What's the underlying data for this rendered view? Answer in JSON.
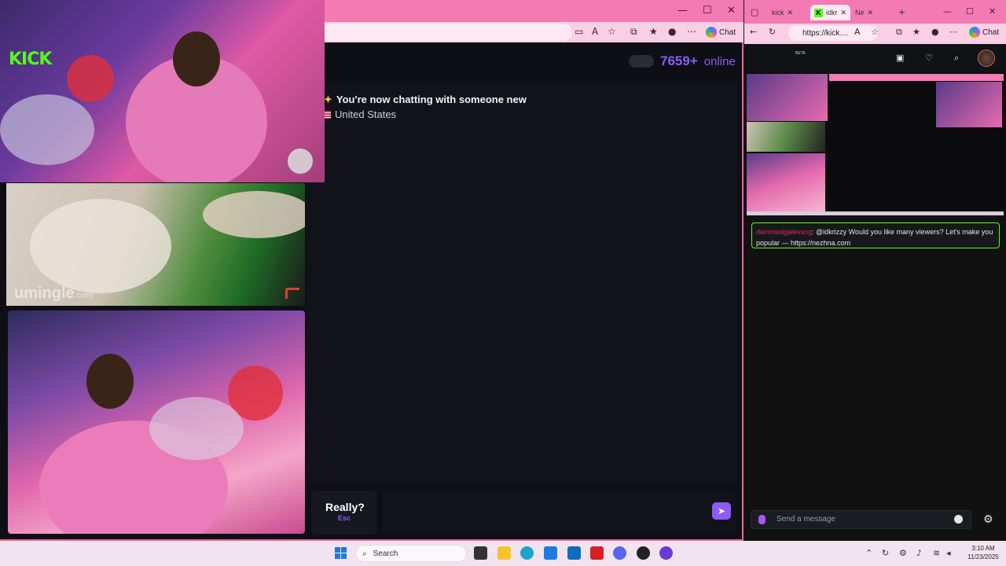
{
  "left_window": {
    "toolbar_chat_label": "Chat",
    "online_count": "7659+",
    "online_label": "online",
    "chat_messages": [
      "You're now chatting with someone new",
      "United States"
    ],
    "really_label": "Really?",
    "esc_label": "Esc",
    "video_logo": "umingle",
    "video_logo_suffix": ".com"
  },
  "right_window": {
    "tabs": [
      {
        "label": "kick",
        "icon": "pink-tab-icon"
      },
      {
        "label": "idkr",
        "icon": "kick-favicon"
      },
      {
        "label": "Ne",
        "icon": "netflix-tab-icon"
      }
    ],
    "url": "https://kick....",
    "chat_label": "Chat",
    "logo": "KICK",
    "logo_badge": "BETA",
    "chat_message": {
      "username": "dammedgalevxog",
      "text": ": @idkrizzy Would you like many viewers? Let's make you popular — https://nezhna.com"
    },
    "send_placeholder": "Send a message"
  },
  "taskbar": {
    "search_label": "Search",
    "time": "3:10 AM",
    "date": "11/23/2025"
  },
  "colors": {
    "kick_green": "#53fc18",
    "umingle_purple": "#8b5cf6",
    "browser_pink": "#f47ab3"
  }
}
